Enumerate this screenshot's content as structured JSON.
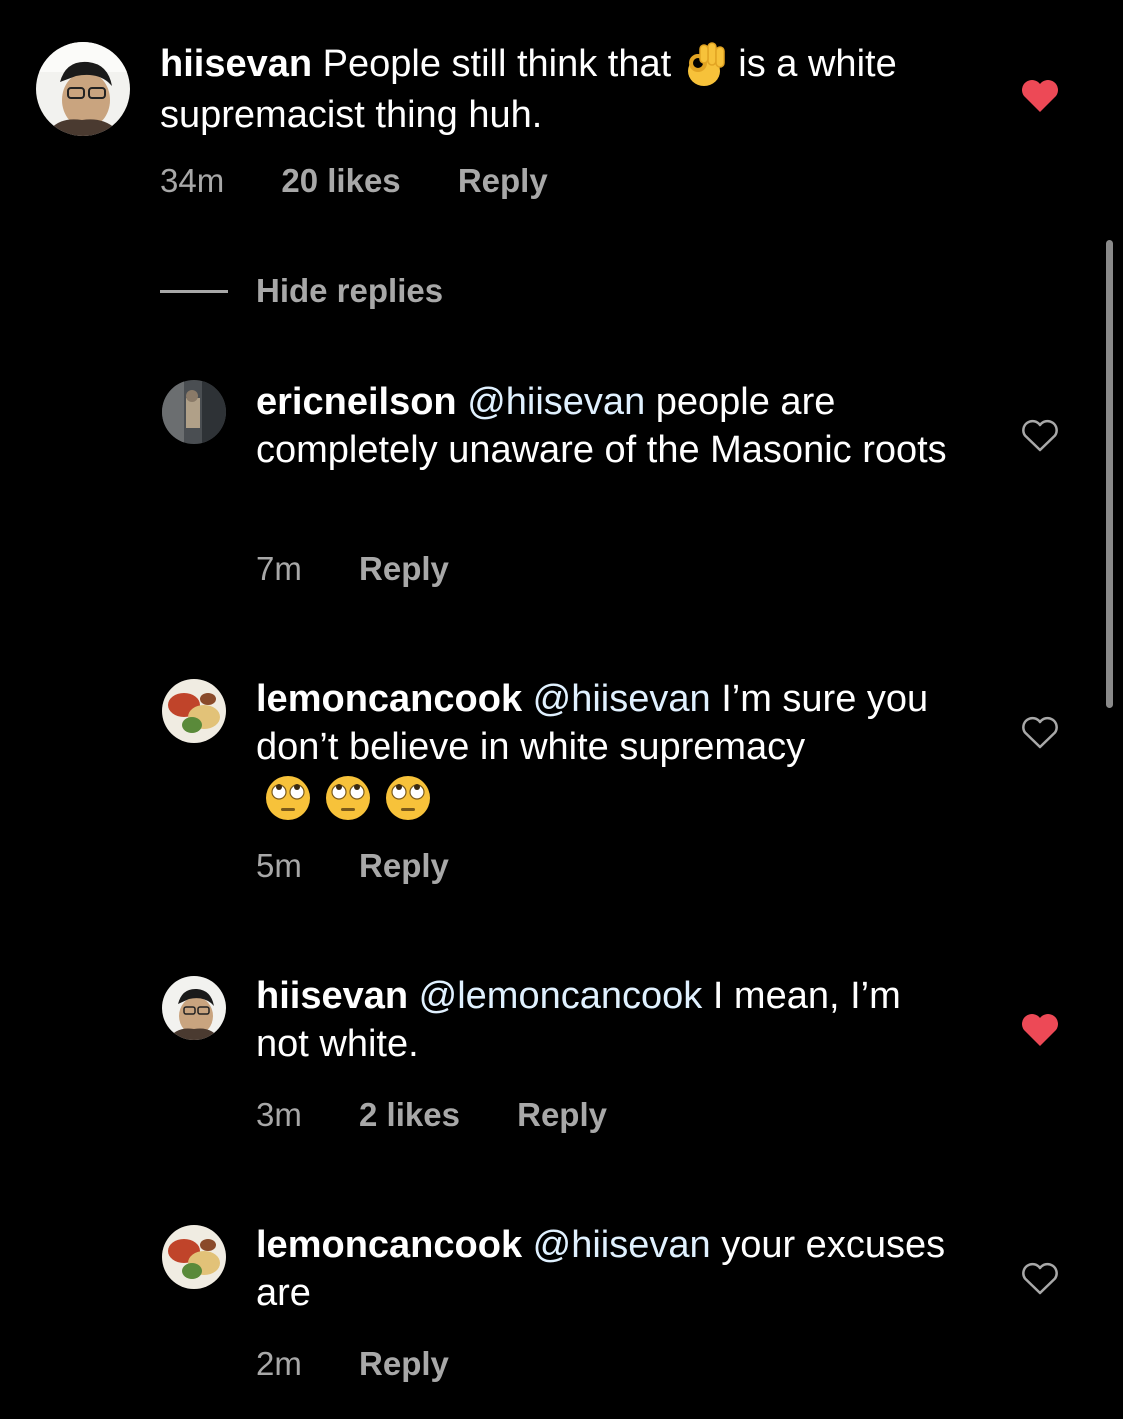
{
  "comments": [
    {
      "username": "hiisevan",
      "mention": "",
      "text_before_emoji": "People still think that",
      "emoji": "ok-hand-emoji",
      "text_after_emoji": "is a white supremacist thing huh.",
      "time": "34m",
      "likes": "20 likes",
      "reply": "Reply",
      "liked": true
    }
  ],
  "replies_toggle": {
    "label": "Hide replies"
  },
  "replies": [
    {
      "username": "ericneilson",
      "mention": "@hiisevan",
      "text": "people are completely unaware of the Masonic roots",
      "time": "7m",
      "reply": "Reply",
      "liked": false
    },
    {
      "username": "lemoncancook",
      "mention": "@hiisevan",
      "text": "I’m sure you don’t believe in white supremacy",
      "emoji": "face-with-rolling-eyes-emoji",
      "emoji_count": 3,
      "time": "5m",
      "reply": "Reply",
      "liked": false
    },
    {
      "username": "hiisevan",
      "mention": "@lemoncancook",
      "text": "I mean, I’m not white.",
      "time": "3m",
      "likes": "2 likes",
      "reply": "Reply",
      "liked": true
    },
    {
      "username": "lemoncancook",
      "mention": "@hiisevan",
      "text": "your excuses are",
      "time": "2m",
      "reply": "Reply",
      "liked": false
    }
  ],
  "colors": {
    "background": "#000000",
    "text": "#ffffff",
    "meta": "#a8a8a8",
    "mention": "#e0f1ff",
    "liked_heart": "#ed4956"
  }
}
